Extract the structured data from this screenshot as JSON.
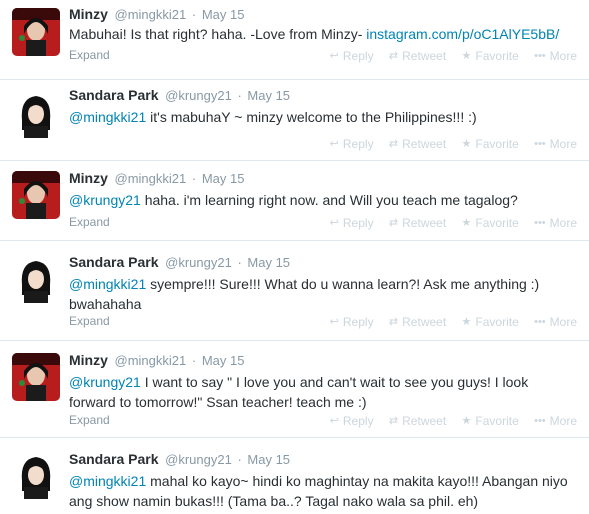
{
  "actions": {
    "reply": "Reply",
    "retweet": "Retweet",
    "favorite": "Favorite",
    "more": "More",
    "expand": "Expand"
  },
  "icons": {
    "reply": "reply-icon",
    "retweet": "retweet-icon",
    "favorite": "star-icon",
    "more": "ellipsis-icon"
  },
  "colors": {
    "link": "#0084b4",
    "muted": "#8899a6",
    "border": "#e1e8ed"
  },
  "tweets": [
    {
      "name": "Minzy",
      "handle": "@mingkki21",
      "date": "May 15",
      "mention": "",
      "text": "Mabuhai! Is that right? haha. -Love from Minzy- ",
      "link": "instagram.com/p/oC1AlYE5bB/"
    },
    {
      "name": "Sandara Park",
      "handle": "@krungy21",
      "date": "May 15",
      "mention": "@mingkki21",
      "text": " it's mabuhaY ~ minzy welcome to the Philippines!!! :)",
      "link": ""
    },
    {
      "name": "Minzy",
      "handle": "@mingkki21",
      "date": "May 15",
      "mention": "@krungy21",
      "text": " haha. i'm learning right now. and Will you teach me tagalog?",
      "link": ""
    },
    {
      "name": "Sandara Park",
      "handle": "@krungy21",
      "date": "May 15",
      "mention": "@mingkki21",
      "text": " syempre!!! Sure!!! What do u wanna learn?! Ask me anything :) bwahahaha",
      "link": ""
    },
    {
      "name": "Minzy",
      "handle": "@mingkki21",
      "date": "May 15",
      "mention": "@krungy21",
      "text": " I want to say \" I love you and can't wait to see you guys! I look forward to tomorrow!\" Ssan teacher! teach me :)",
      "link": ""
    },
    {
      "name": "Sandara Park",
      "handle": "@krungy21",
      "date": "May 15",
      "mention": "@mingkki21",
      "text": " mahal ko kayo~ hindi ko maghintay na makita kayo!!! Abangan niyo ang show namin bukas!!! (Tama ba..? Tagal nako wala sa phil. eh)",
      "link": ""
    }
  ]
}
